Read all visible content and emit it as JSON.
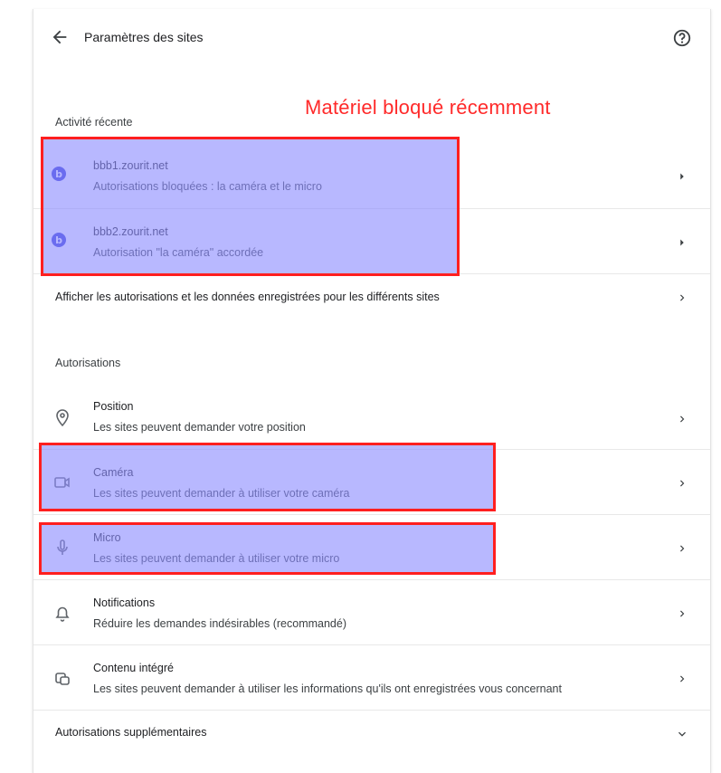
{
  "header": {
    "title": "Paramètres des sites"
  },
  "annotation": "Matériel bloqué récemment",
  "recent": {
    "title": "Activité récente",
    "items": [
      {
        "site": "bbb1.zourit.net",
        "detail": "Autorisations bloquées : la caméra et le micro"
      },
      {
        "site": "bbb2.zourit.net",
        "detail": "Autorisation \"la caméra\" accordée"
      }
    ]
  },
  "all_sites_label": "Afficher les autorisations et les données enregistrées pour les différents sites",
  "permissions": {
    "title": "Autorisations",
    "items": [
      {
        "label": "Position",
        "desc": "Les sites peuvent demander votre position",
        "icon": "location-pin-icon"
      },
      {
        "label": "Caméra",
        "desc": "Les sites peuvent demander à utiliser votre caméra",
        "icon": "camera-icon"
      },
      {
        "label": "Micro",
        "desc": "Les sites peuvent demander à utiliser votre micro",
        "icon": "microphone-icon"
      },
      {
        "label": "Notifications",
        "desc": "Réduire les demandes indésirables (recommandé)",
        "icon": "bell-icon"
      },
      {
        "label": "Contenu intégré",
        "desc": "Les sites peuvent demander à utiliser les informations qu'ils ont enregistrées vous concernant",
        "icon": "embedded-content-icon"
      }
    ]
  },
  "additional_label": "Autorisations supplémentaires",
  "colors": {
    "highlight_fill": "#8c8cff",
    "highlight_border": "#ff1f1f",
    "annotation": "#ff2a2a",
    "site_icon": "#3437d6"
  }
}
